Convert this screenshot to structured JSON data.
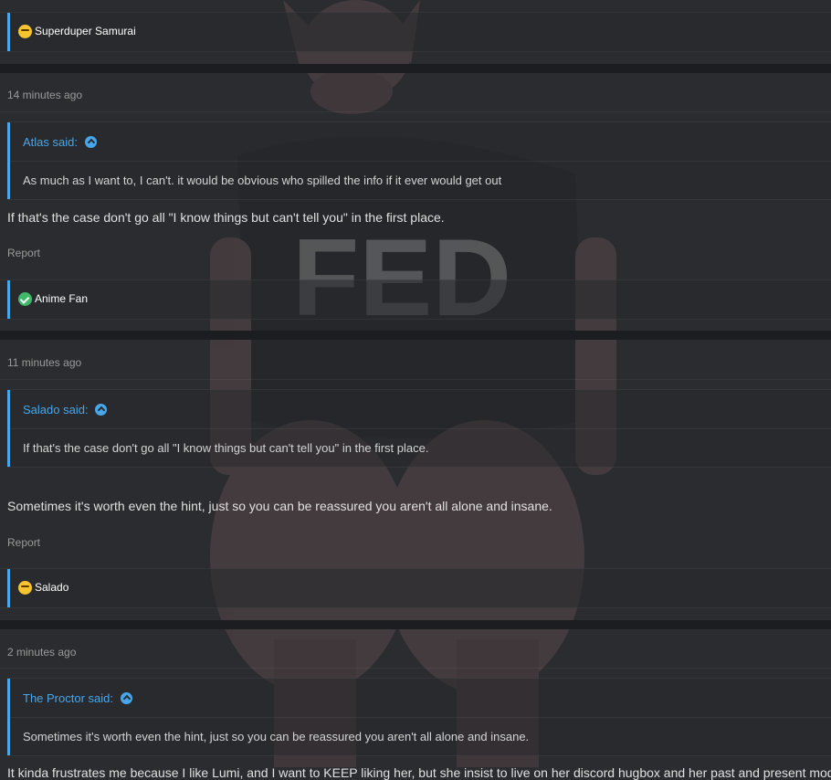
{
  "posts": [
    {
      "reaction_name": "Superduper Samurai",
      "reaction_icon": "thinking-face-icon"
    },
    {
      "timestamp": "14 minutes ago",
      "quote": {
        "attribution": "Atlas said:",
        "text": "As much as I want to, I can't. it would be obvious who spilled the info if it ever would get out"
      },
      "body": "If that's the case don't go all \"I know things but can't tell you\" in the first place.",
      "report": "Report",
      "reaction_name": "Anime Fan",
      "reaction_icon": "check-mark-icon"
    },
    {
      "timestamp": "11 minutes ago",
      "quote": {
        "attribution": "Salado said:",
        "text": "If that's the case don't go all \"I know things but can't tell you\" in the first place."
      },
      "body": "Sometimes it's worth even the hint, just so you can be reassured you aren't all alone and insane.",
      "report": "Report",
      "reaction_name": "Salado",
      "reaction_icon": "thinking-face-icon"
    },
    {
      "timestamp": "2 minutes ago",
      "quote": {
        "attribution": "The Proctor said:",
        "text": "Sometimes it's worth even the hint, just so you can be reassured you aren't all alone and insane."
      },
      "body": "It kinda frustrates me because I like Lumi, and I want to KEEP liking her, but she insist to live on her discord hugbox and her past and present mods"
    }
  ],
  "background": {
    "shirt_text": "FED",
    "icon": "pig-mascot-image"
  },
  "colors": {
    "accent": "#47a7eb",
    "background": "#2a2c30",
    "separator": "#1c1d20"
  }
}
